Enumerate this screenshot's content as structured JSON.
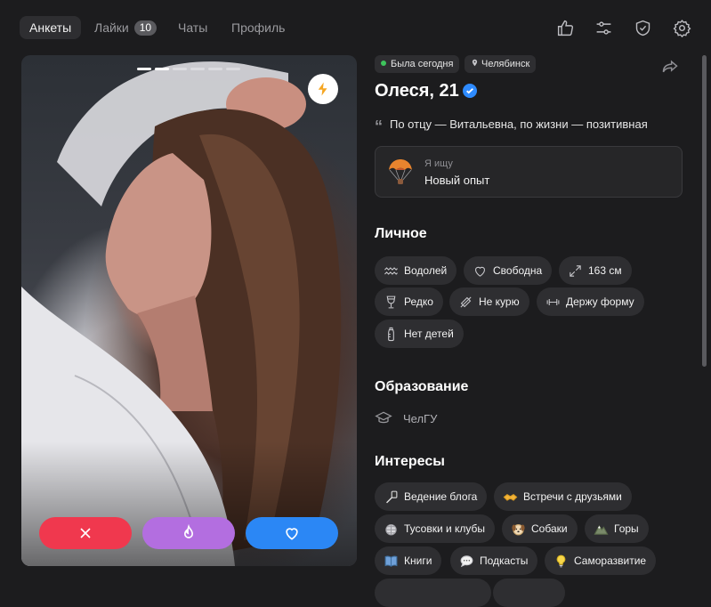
{
  "tabs": [
    {
      "label": "Анкеты"
    },
    {
      "label": "Лайки",
      "badge": "10"
    },
    {
      "label": "Чаты"
    },
    {
      "label": "Профиль"
    }
  ],
  "top_icons": [
    "thumbs-up-icon",
    "sliders-icon",
    "shield-check-icon",
    "gear-icon"
  ],
  "profile": {
    "status": "Была сегодня",
    "city": "Челябинск",
    "name": "Олеся, 21",
    "quote": "По отцу — Витальевна, по жизни — позитивная",
    "seeking_label": "Я ищу",
    "seeking_value": "Новый опыт"
  },
  "sections": {
    "personal": "Личное",
    "education": "Образование",
    "interests": "Интересы"
  },
  "personal": [
    "Водолей",
    "Свободна",
    "163 см",
    "Редко",
    "Не курю",
    "Держу форму",
    "Нет детей"
  ],
  "education": "ЧелГУ",
  "interests": [
    "Ведение блога",
    "Встречи с друзьями",
    "Тусовки и клубы",
    "Собаки",
    "Горы",
    "Книги",
    "Подкасты",
    "Саморазвитие"
  ],
  "colors": {
    "dislike": "#f0384e",
    "superlike": "#b36ee0",
    "like": "#2b87f5",
    "online": "#3ec45c",
    "boost": "#f5a623"
  },
  "photo_indicator": {
    "count": 6,
    "active": 2
  }
}
